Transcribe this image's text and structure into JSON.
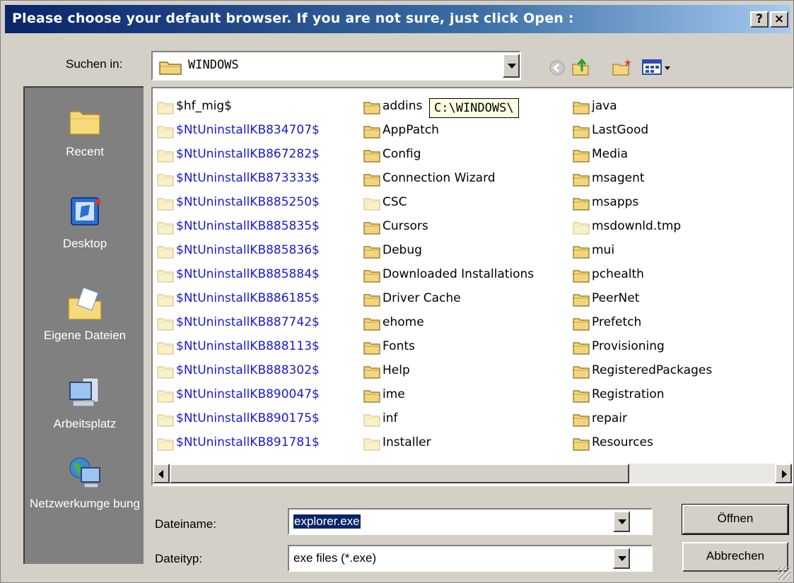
{
  "window": {
    "title": "Please choose your default browser. If you are not sure, just click Open :",
    "help_label": "?",
    "close_label": "×"
  },
  "lookin": {
    "label": "Suchen in:",
    "value": "WINDOWS"
  },
  "toolbar": {
    "icons": [
      "back-icon",
      "up-folder-icon",
      "new-folder-icon",
      "view-menu-icon"
    ]
  },
  "places": [
    {
      "label": "Recent",
      "icon": "recent-icon"
    },
    {
      "label": "Desktop",
      "icon": "desktop-icon"
    },
    {
      "label": "Eigene Dateien",
      "icon": "my-documents-icon"
    },
    {
      "label": "Arbeitsplatz",
      "icon": "my-computer-icon"
    },
    {
      "label": "Netzwerkumge bung",
      "icon": "network-icon"
    }
  ],
  "tooltip": "C:\\WINDOWS\\",
  "files": {
    "col1": [
      {
        "name": "$hf_mig$",
        "style": "pale"
      },
      {
        "name": "$NtUninstallKB834707$",
        "style": "blue"
      },
      {
        "name": "$NtUninstallKB867282$",
        "style": "blue"
      },
      {
        "name": "$NtUninstallKB873333$",
        "style": "blue"
      },
      {
        "name": "$NtUninstallKB885250$",
        "style": "blue"
      },
      {
        "name": "$NtUninstallKB885835$",
        "style": "blue"
      },
      {
        "name": "$NtUninstallKB885836$",
        "style": "blue"
      },
      {
        "name": "$NtUninstallKB885884$",
        "style": "blue"
      },
      {
        "name": "$NtUninstallKB886185$",
        "style": "blue"
      },
      {
        "name": "$NtUninstallKB887742$",
        "style": "blue"
      },
      {
        "name": "$NtUninstallKB888113$",
        "style": "blue"
      },
      {
        "name": "$NtUninstallKB888302$",
        "style": "blue"
      },
      {
        "name": "$NtUninstallKB890047$",
        "style": "blue"
      },
      {
        "name": "$NtUninstallKB890175$",
        "style": "blue"
      },
      {
        "name": "$NtUninstallKB891781$",
        "style": "blue"
      }
    ],
    "col2": [
      {
        "name": "addins",
        "style": "normal"
      },
      {
        "name": "AppPatch",
        "style": "normal"
      },
      {
        "name": "Config",
        "style": "normal"
      },
      {
        "name": "Connection Wizard",
        "style": "normal"
      },
      {
        "name": "CSC",
        "style": "pale"
      },
      {
        "name": "Cursors",
        "style": "normal"
      },
      {
        "name": "Debug",
        "style": "normal"
      },
      {
        "name": "Downloaded Installations",
        "style": "normal"
      },
      {
        "name": "Driver Cache",
        "style": "normal"
      },
      {
        "name": "ehome",
        "style": "normal"
      },
      {
        "name": "Fonts",
        "style": "normal"
      },
      {
        "name": "Help",
        "style": "normal"
      },
      {
        "name": "ime",
        "style": "normal"
      },
      {
        "name": "inf",
        "style": "pale"
      },
      {
        "name": "Installer",
        "style": "pale"
      }
    ],
    "col3": [
      {
        "name": "java",
        "style": "normal"
      },
      {
        "name": "LastGood",
        "style": "normal"
      },
      {
        "name": "Media",
        "style": "normal"
      },
      {
        "name": "msagent",
        "style": "normal"
      },
      {
        "name": "msapps",
        "style": "normal"
      },
      {
        "name": "msdownld.tmp",
        "style": "pale"
      },
      {
        "name": "mui",
        "style": "normal"
      },
      {
        "name": "pchealth",
        "style": "normal"
      },
      {
        "name": "PeerNet",
        "style": "normal"
      },
      {
        "name": "Prefetch",
        "style": "normal"
      },
      {
        "name": "Provisioning",
        "style": "normal"
      },
      {
        "name": "RegisteredPackages",
        "style": "normal"
      },
      {
        "name": "Registration",
        "style": "normal"
      },
      {
        "name": "repair",
        "style": "normal"
      },
      {
        "name": "Resources",
        "style": "normal"
      }
    ]
  },
  "filename": {
    "label": "Dateiname:",
    "value": "explorer.exe"
  },
  "filetype": {
    "label": "Dateityp:",
    "value": "exe files (*.exe)"
  },
  "buttons": {
    "open": "Öffnen",
    "cancel": "Abbrechen"
  },
  "colors": {
    "titlebar_start": "#0a246a",
    "titlebar_end": "#a6caf0",
    "face": "#d4d0c8",
    "places_bg": "#808080",
    "hidden_folder_text": "#1a1acd",
    "tooltip_bg": "#ffffe1"
  }
}
